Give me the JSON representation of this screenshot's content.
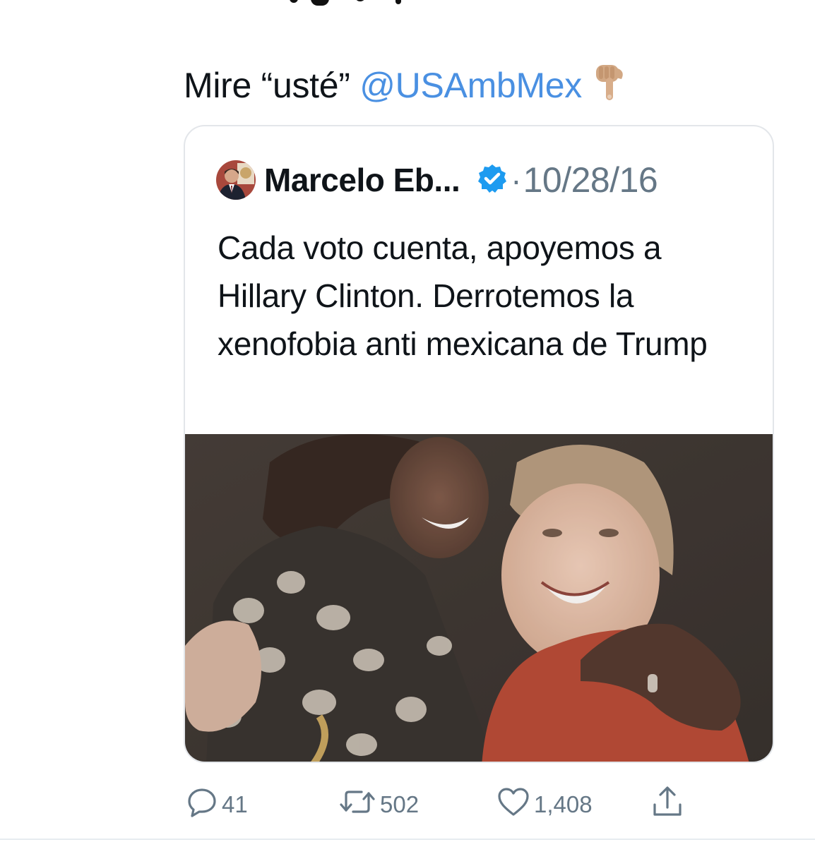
{
  "tweet": {
    "text_prefix": "Mire “usté” ",
    "mention": "@USAmbMex",
    "hand_icon": "backhand-index-pointing-down-icon"
  },
  "quoted_tweet": {
    "author_name": "Marcelo Eb...",
    "verified_icon": "verified-badge-icon",
    "separator": "·",
    "date": "10/28/16",
    "text": "Cada voto cuenta, apoyemos a Hillary Clinton. Derrotemos la xenofobia anti mexicana de Trump"
  },
  "actions": {
    "reply": {
      "icon": "reply-icon",
      "count": "41"
    },
    "retweet": {
      "icon": "retweet-icon",
      "count": "502"
    },
    "like": {
      "icon": "heart-icon",
      "count": "1,408"
    },
    "share": {
      "icon": "share-icon"
    }
  },
  "colors": {
    "mention": "#4a90e2",
    "verified": "#1d9bf0",
    "secondary_text": "#657786"
  }
}
